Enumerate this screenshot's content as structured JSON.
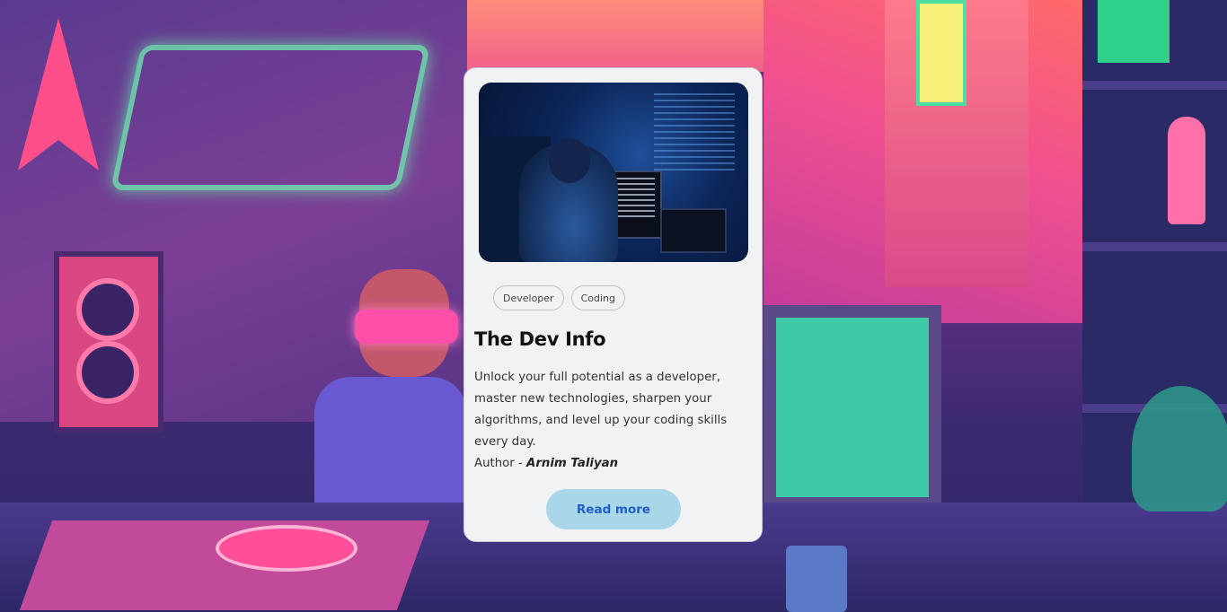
{
  "card": {
    "tags": [
      "Developer",
      "Coding"
    ],
    "title": "The Dev Info",
    "description": "Unlock your full potential as a developer, master new technologies, sharpen your algorithms, and level up your coding skills every day.",
    "author_label": "Author - ",
    "author_name": "Arnim Taliyan",
    "button_label": "Read more"
  },
  "colors": {
    "card_background": "#f1f2f4",
    "button_background": "#a9d6e8",
    "button_text": "#1f5fc8"
  }
}
